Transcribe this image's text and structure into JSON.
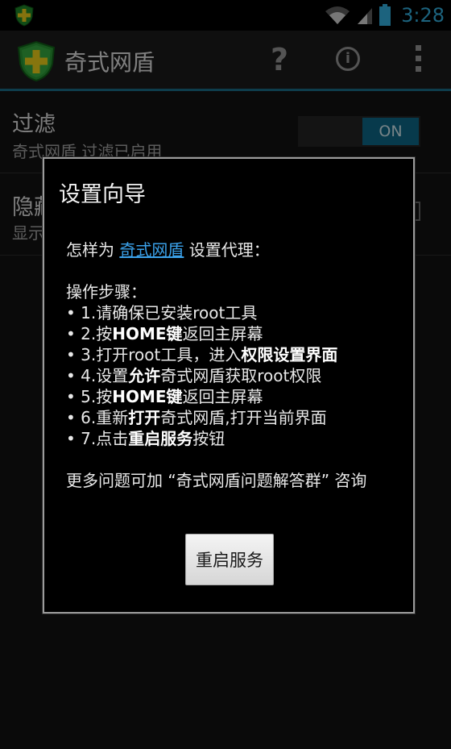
{
  "status_bar": {
    "time": "3:28",
    "icons": [
      "app-shield-icon",
      "wifi-icon",
      "signal-icon",
      "battery-icon"
    ]
  },
  "action_bar": {
    "title": "奇式网盾",
    "help_glyph": "?",
    "info_glyph": "i",
    "icons": [
      "app-logo-icon",
      "help-icon",
      "info-icon",
      "overflow-menu-icon"
    ]
  },
  "preferences": [
    {
      "title": "过滤",
      "summary": "奇式网盾 过滤已启用",
      "control": "toggle",
      "control_label": "ON"
    },
    {
      "title": "隐藏图标",
      "summary": "显示通知图标",
      "control": "checkbox"
    }
  ],
  "dialog": {
    "title": "设置向导",
    "intro_prefix": "怎样为 ",
    "intro_link": "奇式网盾",
    "intro_suffix": " 设置代理：",
    "steps_heading": "操作步骤：",
    "steps": [
      [
        {
          "t": "• 1.请确保已安装root工具",
          "b": false
        }
      ],
      [
        {
          "t": "• 2.按",
          "b": false
        },
        {
          "t": "HOME键",
          "b": true
        },
        {
          "t": "返回主屏幕",
          "b": false
        }
      ],
      [
        {
          "t": "• 3.打开root工具，进入",
          "b": false
        },
        {
          "t": "权限设置界面",
          "b": true
        }
      ],
      [
        {
          "t": "• 4.设置",
          "b": false
        },
        {
          "t": "允许",
          "b": true
        },
        {
          "t": "奇式网盾获取root权限",
          "b": false
        }
      ],
      [
        {
          "t": "• 5.按",
          "b": false
        },
        {
          "t": "HOME键",
          "b": true
        },
        {
          "t": "返回主屏幕",
          "b": false
        }
      ],
      [
        {
          "t": "• 6.重新",
          "b": false
        },
        {
          "t": "打开",
          "b": true
        },
        {
          "t": "奇式网盾,打开当前界面",
          "b": false
        }
      ],
      [
        {
          "t": "• 7.点击",
          "b": false
        },
        {
          "t": "重启服务",
          "b": true
        },
        {
          "t": "按钮",
          "b": false
        }
      ]
    ],
    "footer": "更多问题可加 “奇式网盾问题解答群” 咨询",
    "button_label": "重启服务"
  },
  "colors": {
    "accent": "#33b5e5",
    "link": "#3aa0e8",
    "toggle_on": "#0e6a8a"
  }
}
